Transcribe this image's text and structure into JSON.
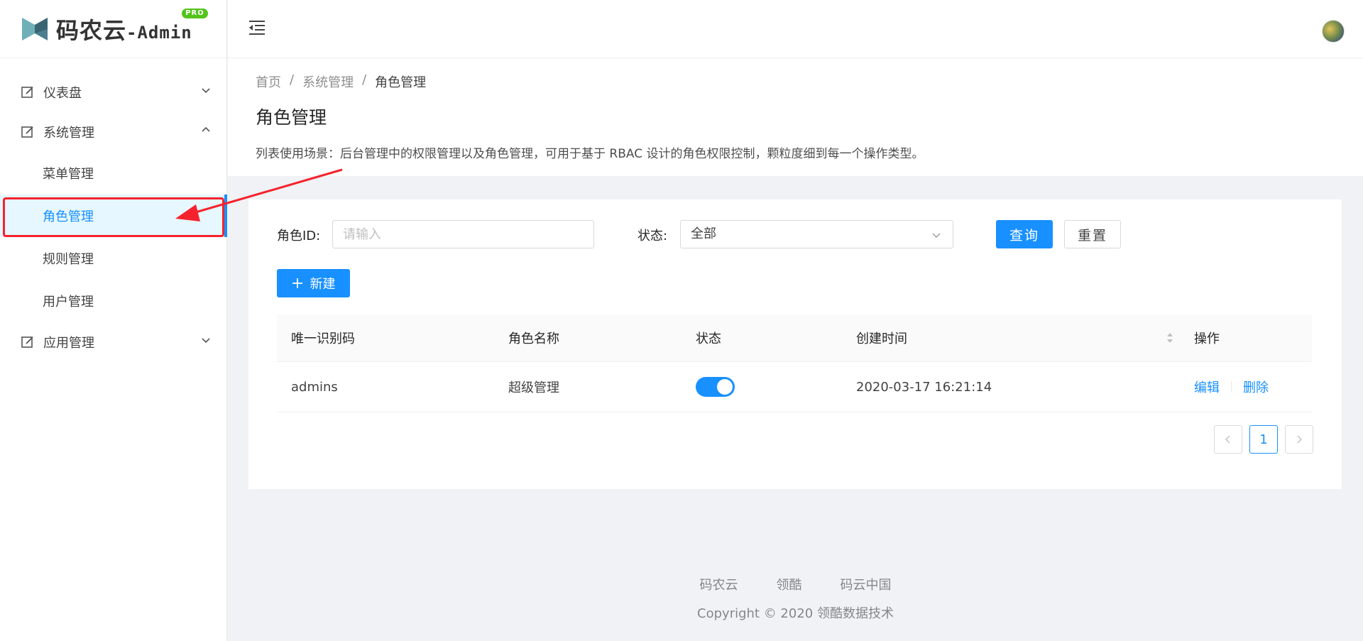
{
  "app": {
    "logo_main": "码农云",
    "logo_suffix": "-Admin",
    "logo_badge": "PRO"
  },
  "sidebar": {
    "items": [
      {
        "label": "仪表盘",
        "icon": "edit-icon",
        "expanded": false
      },
      {
        "label": "系统管理",
        "icon": "edit-icon",
        "expanded": true,
        "children": [
          {
            "label": "菜单管理",
            "active": false
          },
          {
            "label": "角色管理",
            "active": true
          },
          {
            "label": "规则管理",
            "active": false
          },
          {
            "label": "用户管理",
            "active": false
          }
        ]
      },
      {
        "label": "应用管理",
        "icon": "edit-icon",
        "expanded": false
      }
    ]
  },
  "breadcrumb": {
    "items": [
      "首页",
      "系统管理",
      "角色管理"
    ],
    "separator": "/"
  },
  "page": {
    "title": "角色管理",
    "description": "列表使用场景：后台管理中的权限管理以及角色管理，可用于基于 RBAC 设计的角色权限控制，颗粒度细到每一个操作类型。"
  },
  "filters": {
    "role_id_label": "角色ID:",
    "role_id_placeholder": "请输入",
    "status_label": "状态:",
    "status_value": "全部",
    "query_button": "查询",
    "reset_button": "重置"
  },
  "toolbar": {
    "new_button": "新建"
  },
  "table": {
    "columns": [
      "唯一识别码",
      "角色名称",
      "状态",
      "创建时间",
      "操作"
    ],
    "rows": [
      {
        "code": "admins",
        "name": "超级管理",
        "status_on": true,
        "created": "2020-03-17 16:21:14",
        "actions": [
          "编辑",
          "删除"
        ]
      }
    ]
  },
  "pagination": {
    "current": "1"
  },
  "footer": {
    "links": [
      "码农云",
      "领酷",
      "码云中国"
    ],
    "copyright": "Copyright © 2020 领酷数据技术"
  },
  "colors": {
    "primary": "#1890ff",
    "annotation": "#f5222d",
    "active_bg": "#e6f7ff"
  }
}
